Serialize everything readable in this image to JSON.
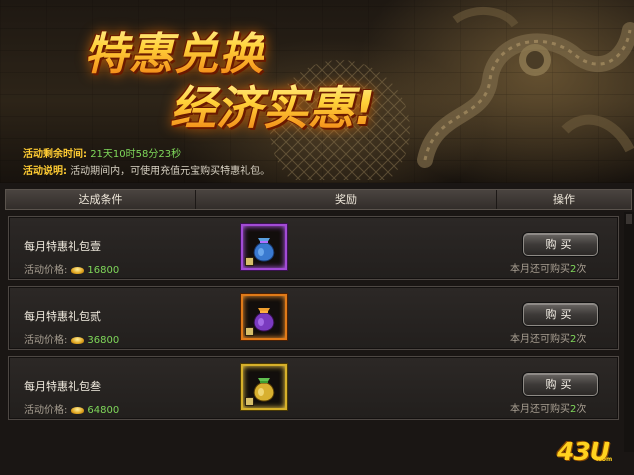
{
  "banner": {
    "title_line1": "特惠兑换",
    "title_line2": "经济实惠!",
    "remaining_label": "活动剩余时间:",
    "remaining_value": "21天10时58分23秒",
    "desc_label": "活动说明:",
    "desc_value": "活动期间内，可使用充值元宝购买特惠礼包。"
  },
  "table": {
    "headers": [
      "达成条件",
      "奖励",
      "操作"
    ],
    "rows": [
      {
        "name": "每月特惠礼包壹",
        "price_label": "活动价格:",
        "price": "16800",
        "buy_label": "购买",
        "remain_prefix": "本月还可购买",
        "remain_count": "2",
        "remain_suffix": "次"
      },
      {
        "name": "每月特惠礼包贰",
        "price_label": "活动价格:",
        "price": "36800",
        "buy_label": "购买",
        "remain_prefix": "本月还可购买",
        "remain_count": "2",
        "remain_suffix": "次"
      },
      {
        "name": "每月特惠礼包叁",
        "price_label": "活动价格:",
        "price": "64800",
        "buy_label": "购买",
        "remain_prefix": "本月还可购买",
        "remain_count": "2",
        "remain_suffix": "次"
      }
    ]
  },
  "icons": {
    "row1": "purple-gift-bag-icon",
    "row2": "orange-gift-bag-icon",
    "row3": "gold-gift-bag-icon",
    "currency": "gold-ingot-icon"
  },
  "colors": {
    "accent_gold": "#ffcc33",
    "value_green": "#7fd85a",
    "tier1": "#a24bd6",
    "tier2": "#e07a18",
    "tier3": "#d6b02a"
  },
  "watermark": {
    "logo": "43U",
    "domain": ".com"
  }
}
